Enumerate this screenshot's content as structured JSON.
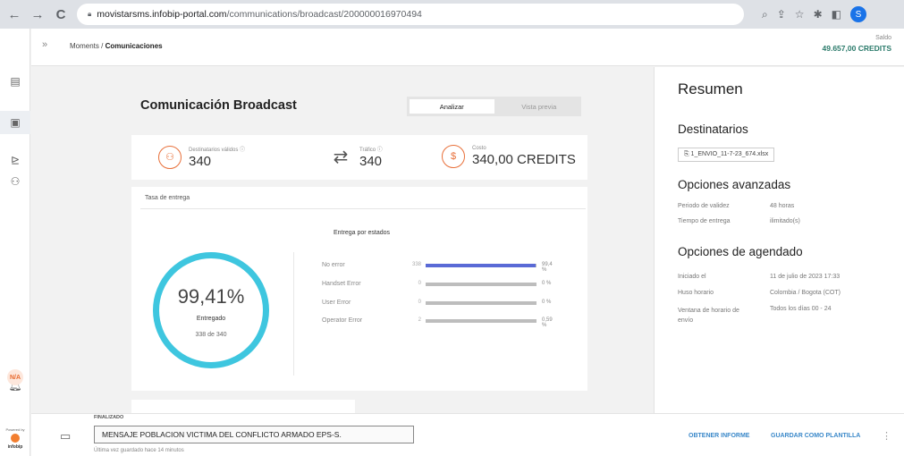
{
  "browser": {
    "url_prefix": "movistarsms.infobip-portal.com",
    "url_path": "/communications/broadcast/200000016970494"
  },
  "header": {
    "breadcrumb_parent": "Moments",
    "breadcrumb_sep": " / ",
    "breadcrumb_current": "Comunicaciones",
    "saldo_label": "Saldo",
    "saldo_value": "49.657,00 CREDITS"
  },
  "sidebar": {
    "badge": "N/A",
    "powered_by": "Powered by",
    "brand": "infobip"
  },
  "main": {
    "title": "Comunicación Broadcast",
    "tabs": [
      {
        "label": "Analizar",
        "active": true
      },
      {
        "label": "Vista previa",
        "active": false
      }
    ],
    "stats": [
      {
        "label": "Destinatarios válidos",
        "value": "340"
      },
      {
        "label": "Tráfico",
        "value": "340"
      },
      {
        "label": "Costo",
        "value": "340,00 CREDITS"
      }
    ],
    "delivery_title": "Tasa de entrega",
    "gauge": {
      "percent": "99,41%",
      "label": "Entregado",
      "count": "338 de 340"
    },
    "states_title": "Entrega por estados",
    "states": [
      {
        "name": "No error",
        "count": "338",
        "pct": "99,4 %",
        "fraction": 0.994,
        "color": "#5a6ad6"
      },
      {
        "name": "Handset Error",
        "count": "0",
        "pct": "0 %",
        "fraction": 0,
        "color": "#bdbdbd"
      },
      {
        "name": "User Error",
        "count": "0",
        "pct": "0 %",
        "fraction": 0,
        "color": "#bdbdbd"
      },
      {
        "name": "Operator Error",
        "count": "2",
        "pct": "0,59 %",
        "fraction": 0.0059,
        "color": "#bdbdbd"
      }
    ]
  },
  "summary": {
    "title": "Resumen",
    "recipients_title": "Destinatarios",
    "file": "1_ENVIO_11-7-23_674.xlsx",
    "advanced_title": "Opciones avanzadas",
    "advanced": [
      {
        "key": "Periodo de validez",
        "value": "48 horas"
      },
      {
        "key": "Tiempo de entrega",
        "value": "ilimitado(s)"
      }
    ],
    "schedule_title": "Opciones de agendado",
    "schedule": [
      {
        "key": "Iniciado el",
        "value": "11 de julio de 2023 17:33"
      },
      {
        "key": "Huso horario",
        "value": "Colombia / Bogota (COT)"
      },
      {
        "key": "Ventana de horario de envío",
        "value": "Todos los días 00 - 24"
      }
    ]
  },
  "footer": {
    "status": "FINALIZADO",
    "message_name": "MENSAJE POBLACION VICTIMA DEL CONFLICTO ARMADO EPS-S.",
    "saved": "Última vez guardado hace 14 minutos",
    "report_button": "OBTENER INFORME",
    "template_button": "GUARDAR COMO PLANTILLA"
  }
}
